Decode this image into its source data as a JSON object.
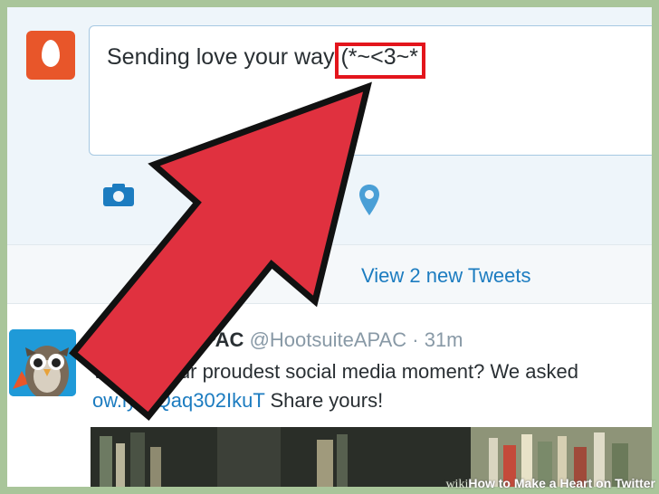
{
  "compose": {
    "tweet_text": "Sending love your way (*~<3~*"
  },
  "stream": {
    "new_tweets_label": "View 2 new Tweets"
  },
  "tweet": {
    "author_name": "Hootsuite APAC",
    "author_handle": "@HootsuiteAPAC",
    "time": "· 31m",
    "text_line1": "What's your proudest social media moment? We asked",
    "link_text": "ow.ly/XQaq302IkuT",
    "text_line2": " Share yours!"
  },
  "watermark": {
    "brand": "wiki",
    "title": "How to Make a Heart on Twitter"
  },
  "colors": {
    "border": "#a9c59a",
    "arrow_fill": "#e0313f",
    "highlight": "#e3151c",
    "link": "#1c7cc0",
    "egg_avatar": "#e8562a"
  },
  "icons": [
    "egg-avatar-icon",
    "camera-icon",
    "location-pin-icon",
    "owl-avatar-icon",
    "pointer-arrow-icon"
  ]
}
